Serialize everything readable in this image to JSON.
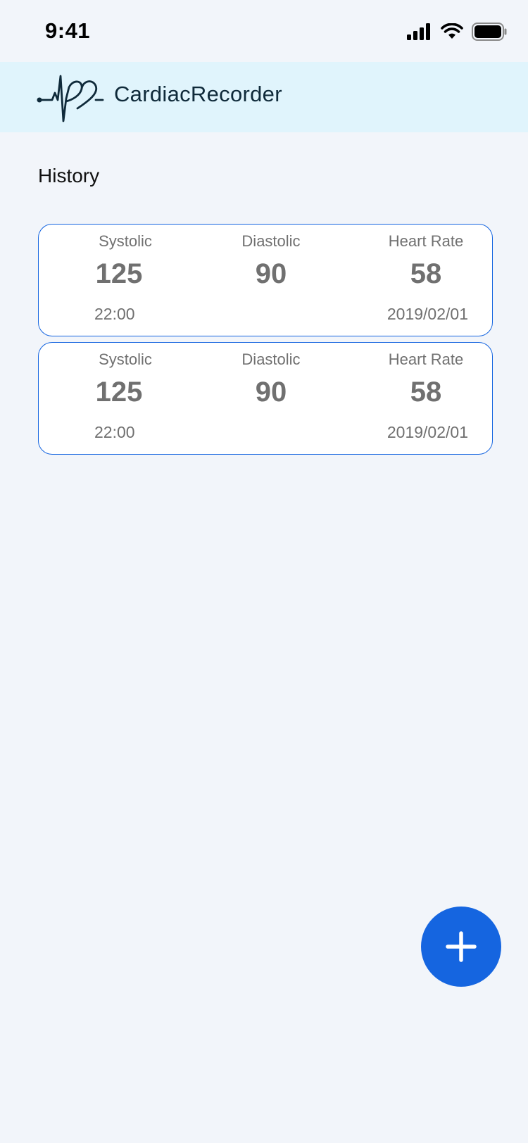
{
  "status_bar": {
    "time": "9:41",
    "icons": [
      "signal-icon",
      "wifi-icon",
      "battery-icon"
    ]
  },
  "header": {
    "logo_icon": "heart-pulse-logo-icon",
    "app_title": "CardiacRecorder"
  },
  "history": {
    "title": "History",
    "records": [
      {
        "systolic_label": "Systolic",
        "systolic_value": "125",
        "diastolic_label": "Diastolic",
        "diastolic_value": "90",
        "heart_rate_label": "Heart Rate",
        "heart_rate_value": "58",
        "time": "22:00",
        "date": "2019/02/01"
      },
      {
        "systolic_label": "Systolic",
        "systolic_value": "125",
        "diastolic_label": "Diastolic",
        "diastolic_value": "90",
        "heart_rate_label": "Heart Rate",
        "heart_rate_value": "58",
        "time": "22:00",
        "date": "2019/02/01"
      }
    ]
  },
  "fab": {
    "icon": "plus-icon"
  },
  "colors": {
    "accent": "#1565e0",
    "header_bg": "#e0f4fc",
    "page_bg": "#f2f5fa",
    "muted_text": "#707070"
  }
}
